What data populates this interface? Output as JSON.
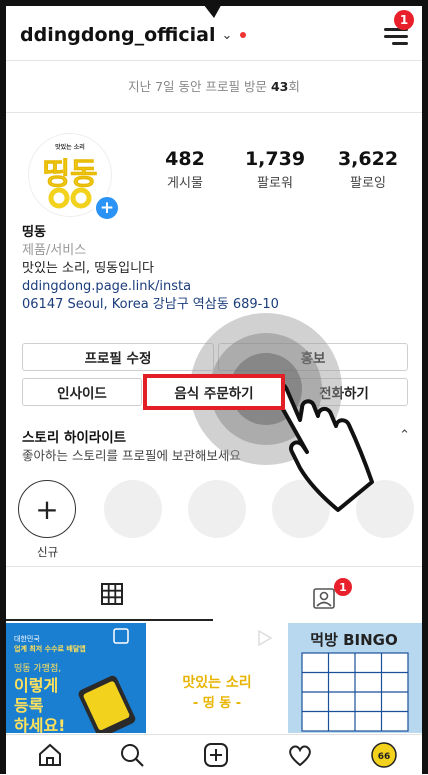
{
  "header": {
    "username": "ddingdong_official",
    "notif_count": "1"
  },
  "visits_prefix": "지난 7일 동안 프로필 방문",
  "visits_count": "43",
  "visits_suffix": "회",
  "avatar": {
    "small_text": "맛있는 소리",
    "logo_text": "띵동"
  },
  "stats": [
    {
      "value": "482",
      "label": "게시물"
    },
    {
      "value": "1,739",
      "label": "팔로워"
    },
    {
      "value": "3,622",
      "label": "팔로잉"
    }
  ],
  "bio": {
    "name": "띵동",
    "category": "제품/서비스",
    "description": "맛있는 소리, 띵동입니다",
    "link": "ddingdong.page.link/insta",
    "address": "06147 Seoul, Korea 강남구 역삼동 689-10"
  },
  "buttons": {
    "edit_profile": "프로필 수정",
    "promote": "홍보",
    "insights": "인사이드",
    "order_food": "음식 주문하기",
    "call": "전화하기"
  },
  "highlights": {
    "title": "스토리 하이라이트",
    "subtitle": "좋아하는 스토리를 프로필에 보관해보세요",
    "new_label": "신규"
  },
  "tabs": {
    "tagged_badge": "1"
  },
  "posts": [
    {
      "lines": [
        "대한민국",
        "업계 최저 수수료 배달앱",
        "띵동 가맹점,",
        "이렇게",
        "등록",
        "하세요!"
      ]
    },
    {
      "lines": [
        "맛있는 소리",
        "- 띵   동 -"
      ]
    },
    {
      "title": "먹방 BINGO"
    }
  ],
  "colors": {
    "accent_red": "#e21f26",
    "brand_yellow": "#f3d21d",
    "link_blue": "#1b3d7c",
    "badge_blue": "#2a93f5"
  }
}
